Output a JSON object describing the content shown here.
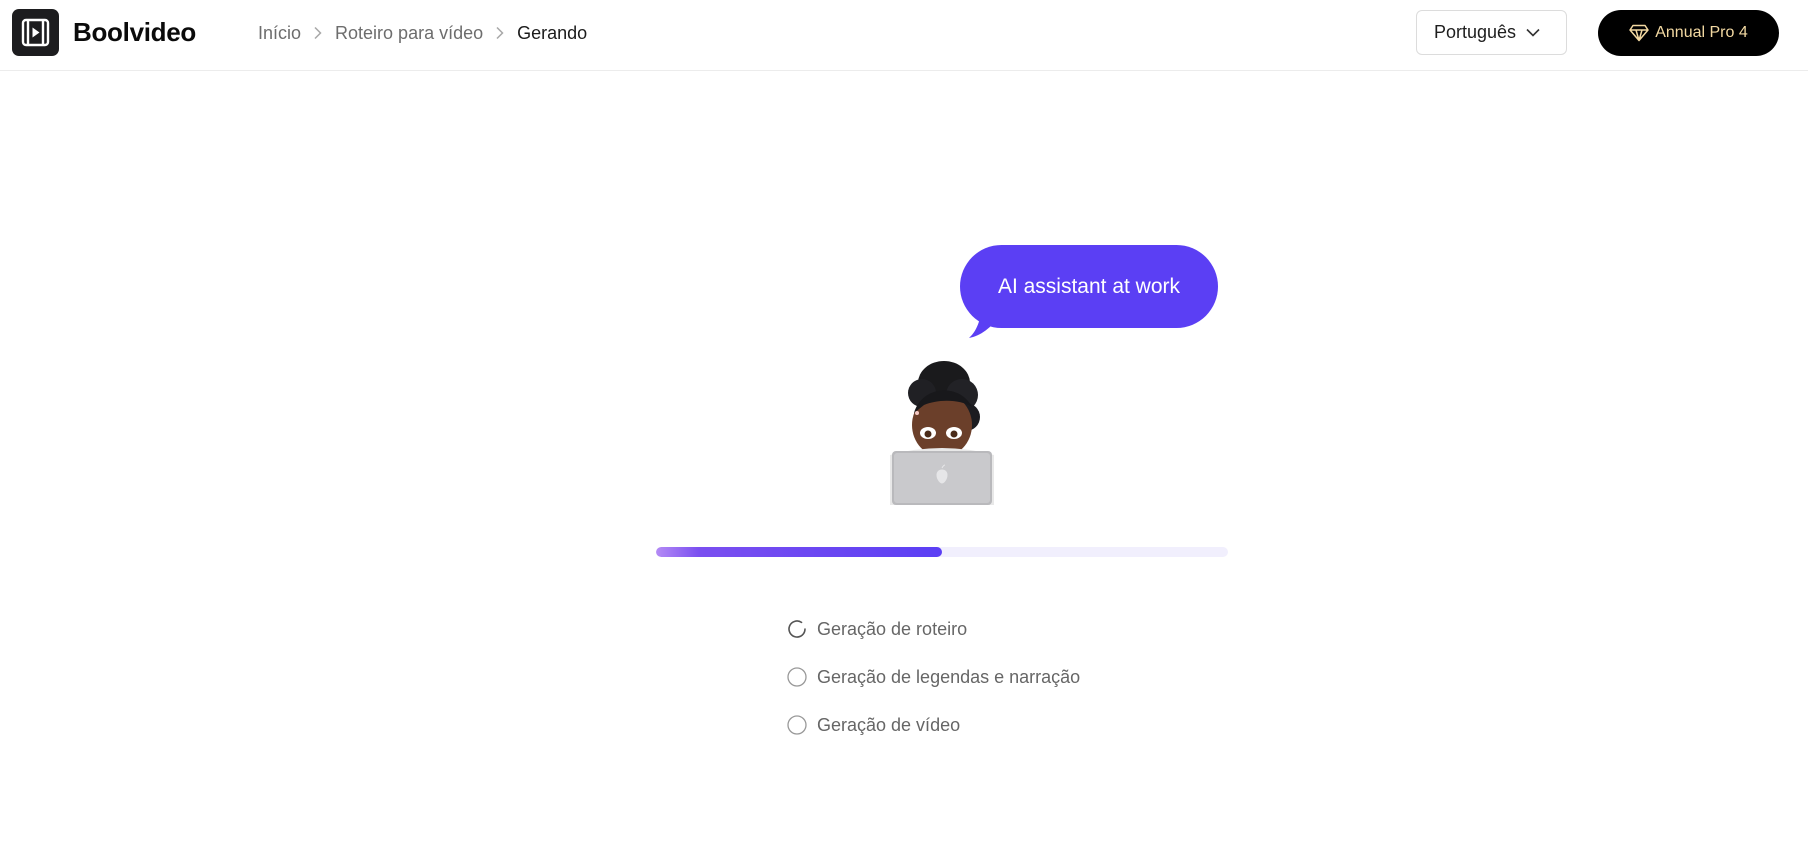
{
  "header": {
    "brand": "Boolvideo",
    "breadcrumb": [
      "Início",
      "Roteiro para vídeo",
      "Gerando"
    ],
    "language": "Português",
    "plan_button": "Annual Pro 4"
  },
  "main": {
    "bubble_text": "AI assistant at work",
    "progress": 0.5,
    "steps": [
      {
        "label": "Geração de roteiro",
        "status": "loading"
      },
      {
        "label": "Geração de legendas e narração",
        "status": "pending"
      },
      {
        "label": "Geração de vídeo",
        "status": "pending"
      }
    ]
  },
  "colors": {
    "accent": "#5b3ff4",
    "plan_text": "#f3d9a2"
  },
  "icons": [
    "video-logo-icon",
    "chevron-right-icon",
    "chevron-down-icon",
    "gem-icon",
    "spinner-icon",
    "circle-icon"
  ]
}
